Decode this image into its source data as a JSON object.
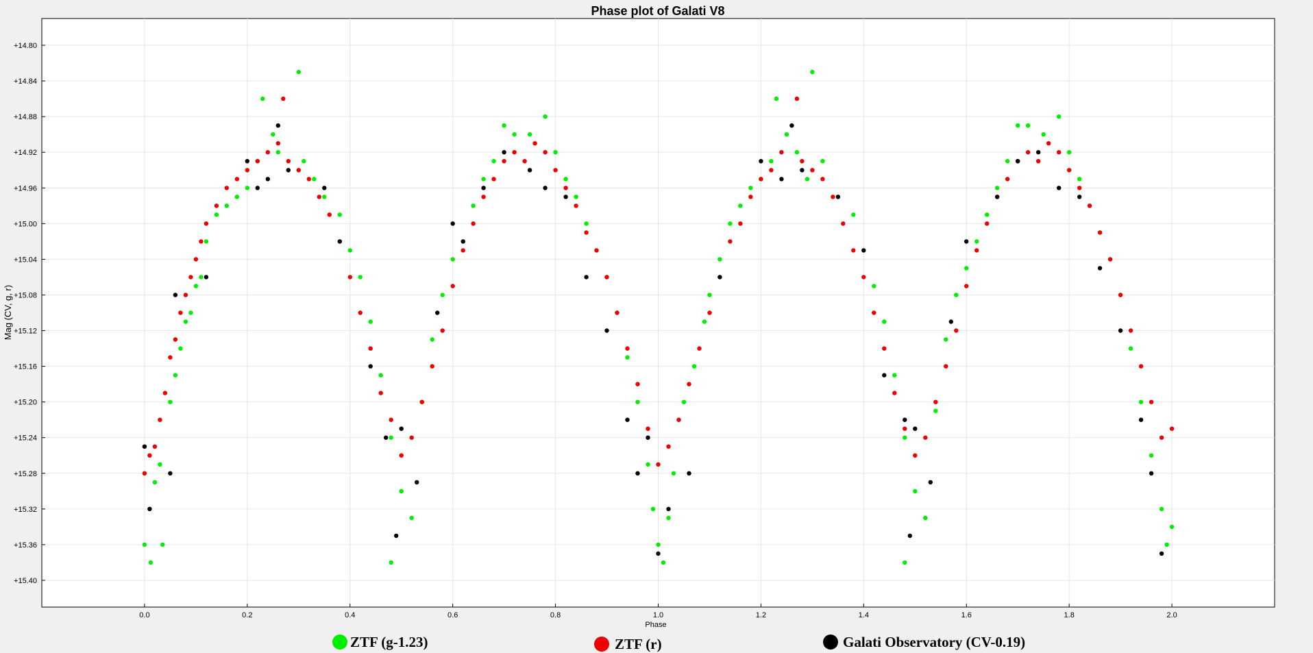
{
  "chart_data": {
    "type": "scatter",
    "title": "Phase plot of Galati V8",
    "xlabel": "Phase",
    "ylabel": "Mag (CV, g, r)",
    "xlim": [
      -0.2,
      2.2
    ],
    "ylim": [
      14.77,
      15.43
    ],
    "y_inverted": true,
    "grid": true,
    "legend_position": "bottom",
    "x_ticks": [
      "0.0",
      "0.2",
      "0.4",
      "0.6",
      "0.8",
      "1.0",
      "1.2",
      "1.4",
      "1.6",
      "1.8",
      "2.0"
    ],
    "y_ticks": [
      "+14.80",
      "+14.84",
      "+14.88",
      "+14.92",
      "+14.96",
      "+15.00",
      "+15.04",
      "+15.08",
      "+15.12",
      "+15.16",
      "+15.20",
      "+15.24",
      "+15.28",
      "+15.32",
      "+15.36",
      "+15.40"
    ],
    "x_tick_values": [
      0.0,
      0.2,
      0.4,
      0.6,
      0.8,
      1.0,
      1.2,
      1.4,
      1.6,
      1.8,
      2.0
    ],
    "y_tick_values": [
      14.8,
      14.84,
      14.88,
      14.92,
      14.96,
      15.0,
      15.04,
      15.08,
      15.12,
      15.16,
      15.2,
      15.24,
      15.28,
      15.32,
      15.36,
      15.4
    ],
    "series": [
      {
        "name": "ZTF (g-1.23)",
        "color": "#00ee00",
        "points": [
          [
            0.0,
            15.36
          ],
          [
            0.01,
            15.32
          ],
          [
            0.012,
            15.38
          ],
          [
            0.02,
            15.29
          ],
          [
            0.03,
            15.27
          ],
          [
            0.035,
            15.36
          ],
          [
            0.05,
            15.2
          ],
          [
            0.06,
            15.17
          ],
          [
            0.07,
            15.14
          ],
          [
            0.08,
            15.11
          ],
          [
            0.09,
            15.1
          ],
          [
            0.1,
            15.07
          ],
          [
            0.11,
            15.06
          ],
          [
            0.12,
            15.02
          ],
          [
            0.14,
            14.99
          ],
          [
            0.16,
            14.98
          ],
          [
            0.18,
            14.97
          ],
          [
            0.2,
            14.96
          ],
          [
            0.22,
            14.93
          ],
          [
            0.23,
            14.86
          ],
          [
            0.25,
            14.9
          ],
          [
            0.26,
            14.92
          ],
          [
            0.28,
            14.94
          ],
          [
            0.3,
            14.83
          ],
          [
            0.31,
            14.93
          ],
          [
            0.33,
            14.95
          ],
          [
            0.35,
            14.97
          ],
          [
            0.38,
            14.99
          ],
          [
            0.4,
            15.03
          ],
          [
            0.42,
            15.06
          ],
          [
            0.44,
            15.11
          ],
          [
            0.46,
            15.17
          ],
          [
            0.48,
            15.24
          ],
          [
            0.48,
            15.38
          ],
          [
            0.5,
            15.3
          ],
          [
            0.52,
            15.33
          ],
          [
            0.54,
            15.2
          ],
          [
            0.56,
            15.13
          ],
          [
            0.58,
            15.08
          ],
          [
            0.6,
            15.04
          ],
          [
            0.62,
            15.02
          ],
          [
            0.64,
            14.98
          ],
          [
            0.66,
            14.95
          ],
          [
            0.68,
            14.93
          ],
          [
            0.7,
            14.89
          ],
          [
            0.72,
            14.9
          ],
          [
            0.75,
            14.9
          ],
          [
            0.78,
            14.88
          ],
          [
            0.8,
            14.92
          ],
          [
            0.82,
            14.95
          ],
          [
            0.84,
            14.97
          ],
          [
            0.86,
            15.0
          ],
          [
            0.88,
            15.03
          ],
          [
            0.9,
            15.06
          ],
          [
            0.92,
            15.1
          ],
          [
            0.94,
            15.15
          ],
          [
            0.96,
            15.2
          ],
          [
            0.98,
            15.27
          ],
          [
            0.99,
            15.32
          ],
          [
            1.0,
            15.36
          ],
          [
            1.01,
            15.38
          ],
          [
            1.02,
            15.33
          ],
          [
            1.03,
            15.28
          ],
          [
            1.05,
            15.2
          ],
          [
            1.07,
            15.16
          ],
          [
            1.09,
            15.11
          ],
          [
            1.1,
            15.08
          ],
          [
            1.12,
            15.04
          ],
          [
            1.14,
            15.0
          ],
          [
            1.16,
            14.98
          ],
          [
            1.18,
            14.96
          ],
          [
            1.2,
            14.95
          ],
          [
            1.22,
            14.93
          ],
          [
            1.23,
            14.86
          ],
          [
            1.25,
            14.9
          ],
          [
            1.27,
            14.92
          ],
          [
            1.29,
            14.95
          ],
          [
            1.3,
            14.83
          ],
          [
            1.32,
            14.93
          ],
          [
            1.35,
            14.97
          ],
          [
            1.38,
            14.99
          ],
          [
            1.4,
            15.03
          ],
          [
            1.42,
            15.07
          ],
          [
            1.44,
            15.11
          ],
          [
            1.46,
            15.17
          ],
          [
            1.48,
            15.24
          ],
          [
            1.48,
            15.38
          ],
          [
            1.5,
            15.3
          ],
          [
            1.52,
            15.33
          ],
          [
            1.54,
            15.21
          ],
          [
            1.56,
            15.13
          ],
          [
            1.58,
            15.08
          ],
          [
            1.6,
            15.05
          ],
          [
            1.62,
            15.02
          ],
          [
            1.64,
            14.99
          ],
          [
            1.66,
            14.96
          ],
          [
            1.68,
            14.93
          ],
          [
            1.7,
            14.89
          ],
          [
            1.72,
            14.89
          ],
          [
            1.75,
            14.9
          ],
          [
            1.78,
            14.88
          ],
          [
            1.8,
            14.92
          ],
          [
            1.82,
            14.95
          ],
          [
            1.84,
            14.98
          ],
          [
            1.86,
            15.01
          ],
          [
            1.88,
            15.04
          ],
          [
            1.9,
            15.08
          ],
          [
            1.92,
            15.14
          ],
          [
            1.94,
            15.2
          ],
          [
            1.96,
            15.26
          ],
          [
            1.98,
            15.32
          ],
          [
            1.99,
            15.36
          ],
          [
            2.0,
            15.34
          ]
        ]
      },
      {
        "name": "ZTF (r)",
        "color": "#ee0000",
        "points": [
          [
            0.0,
            15.28
          ],
          [
            0.01,
            15.26
          ],
          [
            0.02,
            15.25
          ],
          [
            0.03,
            15.22
          ],
          [
            0.04,
            15.19
          ],
          [
            0.05,
            15.15
          ],
          [
            0.06,
            15.13
          ],
          [
            0.07,
            15.1
          ],
          [
            0.08,
            15.08
          ],
          [
            0.09,
            15.06
          ],
          [
            0.1,
            15.04
          ],
          [
            0.11,
            15.02
          ],
          [
            0.12,
            15.0
          ],
          [
            0.14,
            14.98
          ],
          [
            0.16,
            14.96
          ],
          [
            0.18,
            14.95
          ],
          [
            0.2,
            14.94
          ],
          [
            0.22,
            14.93
          ],
          [
            0.24,
            14.92
          ],
          [
            0.26,
            14.91
          ],
          [
            0.27,
            14.86
          ],
          [
            0.28,
            14.93
          ],
          [
            0.3,
            14.94
          ],
          [
            0.32,
            14.95
          ],
          [
            0.34,
            14.97
          ],
          [
            0.36,
            14.99
          ],
          [
            0.38,
            15.02
          ],
          [
            0.4,
            15.06
          ],
          [
            0.42,
            15.1
          ],
          [
            0.44,
            15.14
          ],
          [
            0.46,
            15.19
          ],
          [
            0.48,
            15.22
          ],
          [
            0.5,
            15.26
          ],
          [
            0.52,
            15.24
          ],
          [
            0.54,
            15.2
          ],
          [
            0.56,
            15.16
          ],
          [
            0.58,
            15.12
          ],
          [
            0.6,
            15.07
          ],
          [
            0.62,
            15.03
          ],
          [
            0.64,
            15.0
          ],
          [
            0.66,
            14.97
          ],
          [
            0.68,
            14.95
          ],
          [
            0.7,
            14.93
          ],
          [
            0.72,
            14.92
          ],
          [
            0.74,
            14.93
          ],
          [
            0.76,
            14.91
          ],
          [
            0.78,
            14.92
          ],
          [
            0.8,
            14.94
          ],
          [
            0.82,
            14.96
          ],
          [
            0.84,
            14.98
          ],
          [
            0.86,
            15.01
          ],
          [
            0.88,
            15.03
          ],
          [
            0.9,
            15.06
          ],
          [
            0.92,
            15.1
          ],
          [
            0.94,
            15.14
          ],
          [
            0.96,
            15.18
          ],
          [
            0.98,
            15.23
          ],
          [
            1.0,
            15.27
          ],
          [
            1.02,
            15.25
          ],
          [
            1.04,
            15.22
          ],
          [
            1.06,
            15.18
          ],
          [
            1.08,
            15.14
          ],
          [
            1.1,
            15.1
          ],
          [
            1.12,
            15.06
          ],
          [
            1.14,
            15.02
          ],
          [
            1.16,
            15.0
          ],
          [
            1.18,
            14.97
          ],
          [
            1.2,
            14.95
          ],
          [
            1.22,
            14.94
          ],
          [
            1.24,
            14.92
          ],
          [
            1.27,
            14.86
          ],
          [
            1.28,
            14.93
          ],
          [
            1.3,
            14.94
          ],
          [
            1.32,
            14.95
          ],
          [
            1.34,
            14.97
          ],
          [
            1.36,
            15.0
          ],
          [
            1.38,
            15.03
          ],
          [
            1.4,
            15.06
          ],
          [
            1.42,
            15.1
          ],
          [
            1.44,
            15.14
          ],
          [
            1.46,
            15.19
          ],
          [
            1.48,
            15.23
          ],
          [
            1.5,
            15.26
          ],
          [
            1.52,
            15.24
          ],
          [
            1.54,
            15.2
          ],
          [
            1.56,
            15.16
          ],
          [
            1.58,
            15.12
          ],
          [
            1.6,
            15.07
          ],
          [
            1.62,
            15.03
          ],
          [
            1.64,
            15.0
          ],
          [
            1.66,
            14.97
          ],
          [
            1.68,
            14.95
          ],
          [
            1.7,
            14.93
          ],
          [
            1.72,
            14.92
          ],
          [
            1.74,
            14.93
          ],
          [
            1.76,
            14.91
          ],
          [
            1.78,
            14.92
          ],
          [
            1.8,
            14.94
          ],
          [
            1.82,
            14.96
          ],
          [
            1.84,
            14.98
          ],
          [
            1.86,
            15.01
          ],
          [
            1.88,
            15.04
          ],
          [
            1.9,
            15.08
          ],
          [
            1.92,
            15.12
          ],
          [
            1.94,
            15.16
          ],
          [
            1.96,
            15.2
          ],
          [
            1.98,
            15.24
          ],
          [
            2.0,
            15.23
          ]
        ]
      },
      {
        "name": "Galati Observatory (CV-0.19)",
        "color": "#000000",
        "points": [
          [
            0.0,
            15.25
          ],
          [
            0.01,
            15.32
          ],
          [
            0.05,
            15.28
          ],
          [
            0.06,
            15.08
          ],
          [
            0.12,
            15.06
          ],
          [
            0.2,
            14.93
          ],
          [
            0.22,
            14.96
          ],
          [
            0.24,
            14.95
          ],
          [
            0.26,
            14.89
          ],
          [
            0.28,
            14.94
          ],
          [
            0.35,
            14.96
          ],
          [
            0.38,
            15.02
          ],
          [
            0.44,
            15.16
          ],
          [
            0.47,
            15.24
          ],
          [
            0.49,
            15.35
          ],
          [
            0.5,
            15.23
          ],
          [
            0.53,
            15.29
          ],
          [
            0.57,
            15.1
          ],
          [
            0.6,
            15.0
          ],
          [
            0.62,
            15.02
          ],
          [
            0.66,
            14.96
          ],
          [
            0.7,
            14.92
          ],
          [
            0.75,
            14.94
          ],
          [
            0.78,
            14.96
          ],
          [
            0.82,
            14.97
          ],
          [
            0.86,
            15.06
          ],
          [
            0.9,
            15.12
          ],
          [
            0.94,
            15.22
          ],
          [
            0.96,
            15.28
          ],
          [
            0.98,
            15.24
          ],
          [
            1.0,
            15.37
          ],
          [
            1.02,
            15.32
          ],
          [
            1.06,
            15.28
          ],
          [
            1.12,
            15.06
          ],
          [
            1.2,
            14.93
          ],
          [
            1.24,
            14.95
          ],
          [
            1.26,
            14.89
          ],
          [
            1.28,
            14.94
          ],
          [
            1.35,
            14.97
          ],
          [
            1.4,
            15.03
          ],
          [
            1.44,
            15.17
          ],
          [
            1.48,
            15.22
          ],
          [
            1.49,
            15.35
          ],
          [
            1.5,
            15.23
          ],
          [
            1.53,
            15.29
          ],
          [
            1.57,
            15.11
          ],
          [
            1.6,
            15.02
          ],
          [
            1.66,
            14.97
          ],
          [
            1.7,
            14.93
          ],
          [
            1.74,
            14.92
          ],
          [
            1.78,
            14.96
          ],
          [
            1.82,
            14.97
          ],
          [
            1.86,
            15.05
          ],
          [
            1.9,
            15.12
          ],
          [
            1.94,
            15.22
          ],
          [
            1.96,
            15.28
          ],
          [
            1.98,
            15.37
          ]
        ]
      }
    ]
  }
}
